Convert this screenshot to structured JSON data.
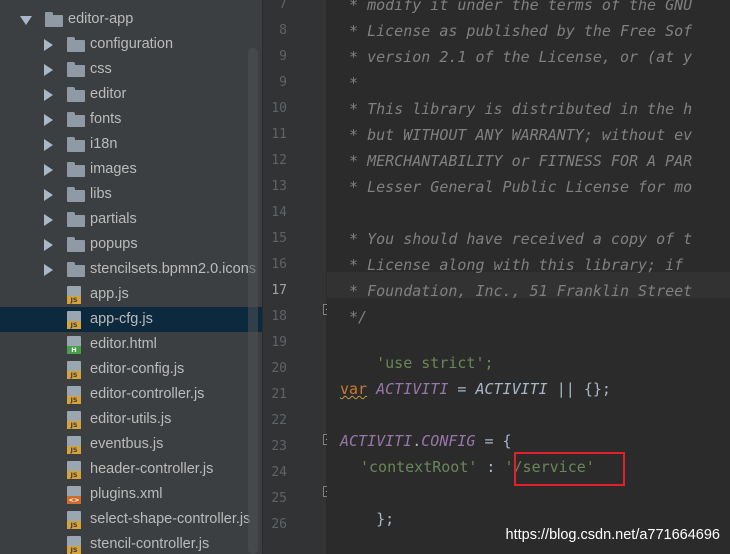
{
  "project_tree": {
    "root": {
      "label": "editor-app",
      "expanded": true
    },
    "folders": [
      {
        "label": "configuration"
      },
      {
        "label": "css"
      },
      {
        "label": "editor"
      },
      {
        "label": "fonts"
      },
      {
        "label": "i18n"
      },
      {
        "label": "images"
      },
      {
        "label": "libs"
      },
      {
        "label": "partials"
      },
      {
        "label": "popups"
      },
      {
        "label": "stencilsets.bpmn2.0.icons"
      }
    ],
    "files": [
      {
        "label": "app.js",
        "badge": "JS",
        "selected": false
      },
      {
        "label": "app-cfg.js",
        "badge": "JS",
        "selected": true
      },
      {
        "label": "editor.html",
        "badge": "H",
        "selected": false
      },
      {
        "label": "editor-config.js",
        "badge": "JS",
        "selected": false
      },
      {
        "label": "editor-controller.js",
        "badge": "JS",
        "selected": false
      },
      {
        "label": "editor-utils.js",
        "badge": "JS",
        "selected": false
      },
      {
        "label": "eventbus.js",
        "badge": "JS",
        "selected": false
      },
      {
        "label": "header-controller.js",
        "badge": "JS",
        "selected": false
      },
      {
        "label": "plugins.xml",
        "badge": "<>",
        "selected": false
      },
      {
        "label": "select-shape-controller.js",
        "badge": "JS",
        "selected": false
      },
      {
        "label": "stencil-controller.js",
        "badge": "JS",
        "selected": false
      }
    ]
  },
  "editor": {
    "current_line": "17",
    "lines": [
      {
        "no": "7",
        "text": " * modify it under the terms of the GNU"
      },
      {
        "no": "8",
        "text": " * License as published by the Free Sof"
      },
      {
        "no": "9",
        "text": " * version 2.1 of the License, or (at y"
      },
      {
        "no": "9",
        "text": " *"
      },
      {
        "no": "10",
        "text": " * This library is distributed in the h"
      },
      {
        "no": "11",
        "text": " * but WITHOUT ANY WARRANTY; without ev"
      },
      {
        "no": "12",
        "text": " * MERCHANTABILITY or FITNESS FOR A PAR"
      },
      {
        "no": "13",
        "text": " * Lesser General Public License for mo"
      },
      {
        "no": "14",
        "text": ""
      },
      {
        "no": "15",
        "text": " * You should have received a copy of t"
      },
      {
        "no": "16",
        "text": " * License along with this library; if"
      },
      {
        "no": "17",
        "text": " * Foundation, Inc., 51 Franklin Street"
      },
      {
        "no": "18",
        "text": " */"
      },
      {
        "no": "19",
        "text": ""
      },
      {
        "no": "20",
        "text": ""
      },
      {
        "no": "21",
        "text": ""
      },
      {
        "no": "22",
        "text": ""
      },
      {
        "no": "23",
        "text": ""
      },
      {
        "no": "24",
        "text": ""
      },
      {
        "no": "25",
        "text": ""
      },
      {
        "no": "26",
        "text": ""
      }
    ],
    "code": {
      "use_strict": "'use strict';",
      "var_kw": "var",
      "activiti_ident": "ACTIVITI",
      "eq": " = ",
      "activiti_ref": "ACTIVITI",
      "or_default": " || {};",
      "config_obj": "ACTIVITI",
      "dot": ".",
      "config_prop": "CONFIG",
      "assign_open": " = {",
      "context_key": "'contextRoot'",
      "colon": " : ",
      "context_value": "'/service'",
      "close": "};"
    }
  },
  "watermark": "https://blog.csdn.net/a771664696",
  "colors": {
    "tree_bg": "#3c3f41",
    "editor_bg": "#2b2b2b",
    "comment": "#808080",
    "string": "#6a8759",
    "keyword": "#cc7832",
    "global": "#9876aa",
    "highlight_border": "#e0202a"
  }
}
